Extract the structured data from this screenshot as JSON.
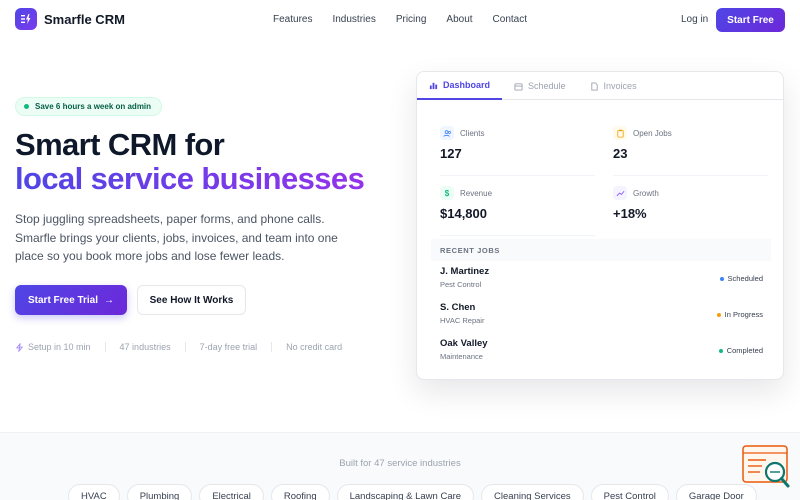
{
  "brand": {
    "name": "Smarfle CRM"
  },
  "nav": {
    "links": [
      "Features",
      "Industries",
      "Pricing",
      "About",
      "Contact"
    ],
    "login": "Log in",
    "cta": "Start Free"
  },
  "hero": {
    "badge": "Save 6 hours a week on admin",
    "title_line1": "Smart CRM for",
    "title_line2": "local service businesses",
    "subtitle": "Stop juggling spreadsheets, paper forms, and phone calls. Smarfle brings your clients, jobs, invoices, and team into one place so you book more jobs and lose fewer leads.",
    "primary_cta": "Start Free Trial",
    "secondary_cta": "See How It Works",
    "stats": [
      "Setup in 10 min",
      "47 industries",
      "7-day free trial",
      "No credit card"
    ]
  },
  "dashboard": {
    "tabs": [
      "Dashboard",
      "Schedule",
      "Invoices"
    ],
    "active_tab": 0,
    "metrics": [
      {
        "label": "Clients",
        "value": "127",
        "icon": "users-icon",
        "color": "#3b82f6"
      },
      {
        "label": "Open Jobs",
        "value": "23",
        "icon": "clipboard-icon",
        "color": "#f59e0b"
      },
      {
        "label": "Revenue",
        "value": "$14,800",
        "icon": "dollar-icon",
        "color": "#10b981"
      },
      {
        "label": "Growth",
        "value": "+18%",
        "icon": "trend-up-icon",
        "color": "#8b5cf6"
      }
    ],
    "recent_jobs_title": "RECENT JOBS",
    "jobs": [
      {
        "name": "J. Martinez",
        "type": "Pest Control",
        "status": "Scheduled",
        "color": "#3b82f6"
      },
      {
        "name": "S. Chen",
        "type": "HVAC Repair",
        "status": "In Progress",
        "color": "#f59e0b"
      },
      {
        "name": "Oak Valley",
        "type": "Maintenance",
        "status": "Completed",
        "color": "#10b981"
      }
    ]
  },
  "industries": {
    "title": "Built for 47 service industries",
    "chips": [
      "HVAC",
      "Plumbing",
      "Electrical",
      "Roofing",
      "Landscaping & Lawn Care",
      "Cleaning Services",
      "Pest Control",
      "Garage Door"
    ]
  },
  "colors": {
    "accent": "#4f46e5",
    "accent2": "#9333ea"
  }
}
